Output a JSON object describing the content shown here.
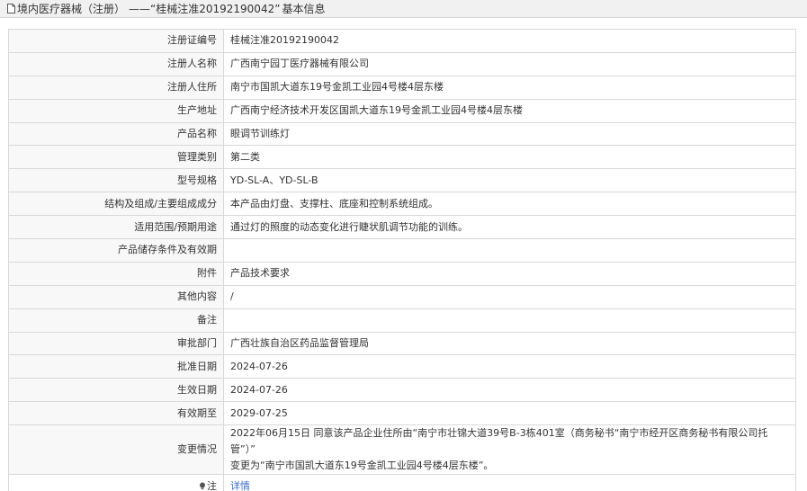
{
  "header": {
    "category": "境内医疗器械（注册）",
    "separator": "——",
    "cert_quoted": "“桂械注准20192190042”",
    "suffix": "基本信息",
    "icon": "document-icon"
  },
  "rows": [
    {
      "label": "注册证编号",
      "value": "桂械注准20192190042"
    },
    {
      "label": "注册人名称",
      "value": "广西南宁园丁医疗器械有限公司"
    },
    {
      "label": "注册人住所",
      "value": "南宁市国凯大道东19号金凯工业园4号楼4层东楼"
    },
    {
      "label": "生产地址",
      "value": "广西南宁经济技术开发区国凯大道东19号金凯工业园4号楼4层东楼"
    },
    {
      "label": "产品名称",
      "value": "眼调节训练灯"
    },
    {
      "label": "管理类别",
      "value": "第二类"
    },
    {
      "label": "型号规格",
      "value": "YD-SL-A、YD-SL-B"
    },
    {
      "label": "结构及组成/主要组成成分",
      "value": "本产品由灯盘、支撑柱、底座和控制系统组成。"
    },
    {
      "label": "适用范围/预期用途",
      "value": "通过灯的照度的动态变化进行睫状肌调节功能的训练。"
    },
    {
      "label": "产品储存条件及有效期",
      "value": ""
    },
    {
      "label": "附件",
      "value": "产品技术要求"
    },
    {
      "label": "其他内容",
      "value": "/"
    },
    {
      "label": "备注",
      "value": ""
    },
    {
      "label": "审批部门",
      "value": "广西壮族自治区药品监督管理局"
    },
    {
      "label": "批准日期",
      "value": "2024-07-26"
    },
    {
      "label": "生效日期",
      "value": "2024-07-26"
    },
    {
      "label": "有效期至",
      "value": "2029-07-25"
    }
  ],
  "change": {
    "label": "变更情况",
    "line1": "2022年06月15日 同意该产品企业住所由“南宁市壮锦大道39号B-3栋401室（商务秘书“南宁市经开区商务秘书有限公司托管”）”",
    "line2": "变更为“南宁市国凯大道东19号金凯工业园4号楼4层东楼”。"
  },
  "note": {
    "label": "注",
    "icon": "lightbulb-icon",
    "link": "详情",
    "link_color": "#3a6ec8"
  }
}
